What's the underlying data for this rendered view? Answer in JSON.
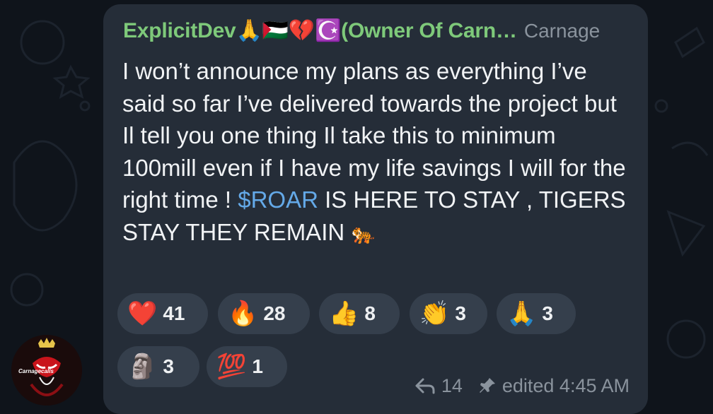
{
  "message": {
    "sender_name": "ExplicitDev🙏🇵🇸💔☪️(Owner Of Carn…",
    "sender_badge": "Carnage",
    "text_part1": "I won’t announce my plans as everything I’ve said so far I’ve delivered towards the project but Il tell you one thing Il take this to minimum 100mill even if I have my life savings I will for the right time ! ",
    "cashtag": "$ROAR",
    "text_part2": " IS HERE TO STAY , TIGERS STAY THEY REMAIN ",
    "trailing_emoji": "🐅"
  },
  "reactions": [
    {
      "emoji": "❤️",
      "count": "41"
    },
    {
      "emoji": "🔥",
      "count": "28"
    },
    {
      "emoji": "👍",
      "count": "8"
    },
    {
      "emoji": "👏",
      "count": "3"
    },
    {
      "emoji": "🙏",
      "count": "3"
    },
    {
      "emoji": "🗿",
      "count": "3"
    },
    {
      "emoji": "💯",
      "count": "1"
    }
  ],
  "footer": {
    "replies_icon": "reply-arrow-icon",
    "replies_count": "14",
    "pin_icon": "pin-icon",
    "edited_time": "edited 4:45 AM"
  },
  "avatar": {
    "label": "Carnagecalls"
  },
  "colors": {
    "background": "#0f141b",
    "bubble": "#252d38",
    "sender": "#7ec97a",
    "link": "#64a9e8",
    "reaction_bg": "#353f4c",
    "meta": "#8a939d"
  }
}
